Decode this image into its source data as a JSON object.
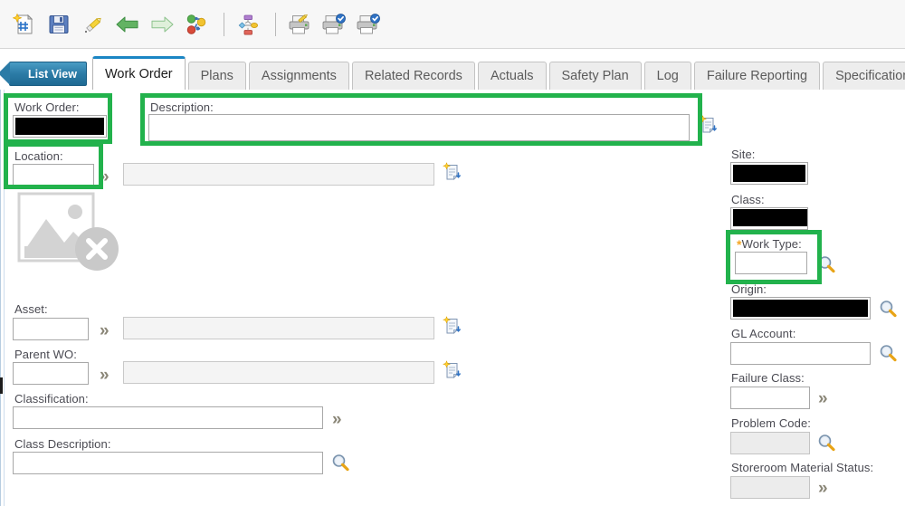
{
  "toolbar": {
    "buttons": [
      {
        "name": "new-work-order-icon",
        "label": "New Work Order"
      },
      {
        "name": "save-icon",
        "label": "Save Work Order"
      },
      {
        "name": "clear-changes-icon",
        "label": "Clear Changes"
      },
      {
        "name": "previous-record-icon",
        "label": "Previous Record"
      },
      {
        "name": "next-record-icon",
        "label": "Next Record"
      },
      {
        "name": "select-action-icon",
        "label": "Select Action"
      },
      {
        "name": "route-workflow-icon",
        "label": "Route Workflow"
      },
      {
        "name": "create-report-icon",
        "label": "Create Report"
      },
      {
        "name": "print-work-order-icon",
        "label": "Print Work Order"
      },
      {
        "name": "print-work-packet-icon",
        "label": "Print Work Packet"
      }
    ]
  },
  "tabs": {
    "list_view_label": "List View",
    "items": [
      {
        "label": "Work Order",
        "active": true
      },
      {
        "label": "Plans",
        "active": false
      },
      {
        "label": "Assignments",
        "active": false
      },
      {
        "label": "Related Records",
        "active": false
      },
      {
        "label": "Actuals",
        "active": false
      },
      {
        "label": "Safety Plan",
        "active": false
      },
      {
        "label": "Log",
        "active": false
      },
      {
        "label": "Failure Reporting",
        "active": false
      },
      {
        "label": "Specifications",
        "active": false
      }
    ]
  },
  "form": {
    "work_order": {
      "label": "Work Order:",
      "value": "",
      "redacted": true
    },
    "description": {
      "label": "Description:",
      "value": "",
      "placeholder": ""
    },
    "location": {
      "label": "Location:",
      "value": "",
      "description_value": ""
    },
    "asset": {
      "label": "Asset:",
      "value": "",
      "description_value": ""
    },
    "parent_wo": {
      "label": "Parent WO:",
      "value": "",
      "description_value": ""
    },
    "classification": {
      "label": "Classification:",
      "value": ""
    },
    "class_description": {
      "label": "Class Description:",
      "value": ""
    },
    "site": {
      "label": "Site:",
      "value": "",
      "redacted": true
    },
    "class": {
      "label": "Class:",
      "value": "",
      "redacted": true
    },
    "work_type": {
      "label": "Work Type:",
      "value": "",
      "required": true,
      "required_marker": "*"
    },
    "origin": {
      "label": "Origin:",
      "value": "",
      "redacted": true
    },
    "gl_account": {
      "label": "GL Account:",
      "value": ""
    },
    "failure_class": {
      "label": "Failure Class:",
      "value": ""
    },
    "problem_code": {
      "label": "Problem Code:",
      "value": "",
      "disabled": true
    },
    "storeroom_material_status": {
      "label": "Storeroom Material Status:",
      "value": "",
      "disabled": true
    }
  },
  "image_placeholder": {
    "name": "broken-image-placeholder",
    "alt": ""
  },
  "highlights": {
    "color": "#22b24c",
    "regions": [
      "work-order-field",
      "location-field",
      "description-field",
      "work-type-field"
    ]
  },
  "colors": {
    "accent_tab": "#1b86c4",
    "highlight_green": "#22b24c",
    "required_marker": "#f5a623",
    "toolbar_bg": "#f7f7f7",
    "label_text": "#4a4a52"
  }
}
